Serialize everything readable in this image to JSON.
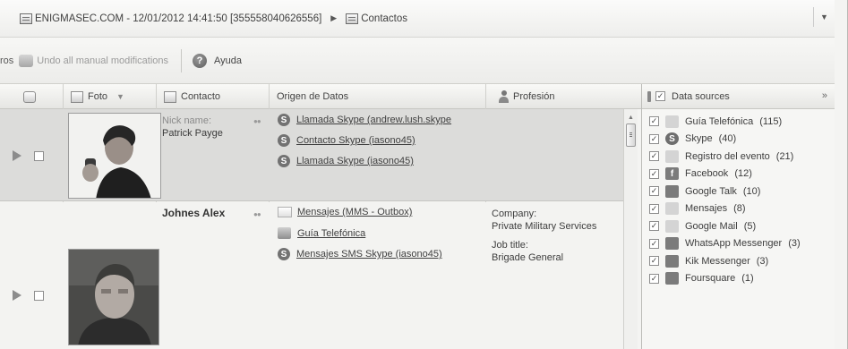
{
  "title_bar": {
    "device_label": "ENIGMASEC.COM - 12/01/2012 14:41:50 [355558040626556]",
    "separator": "▶",
    "section_label": "Contactos",
    "dropdown_glyph": "▼"
  },
  "toolbar": {
    "left_truncated": "ros",
    "undo_label": "Undo all manual modifications",
    "help_label": "Ayuda"
  },
  "grid": {
    "columns": {
      "foto": "Foto",
      "contacto": "Contacto",
      "origen": "Origen de Datos",
      "profesion": "Profesión"
    },
    "rows": [
      {
        "nick_label": "Nick name:",
        "name": "Patrick Payge",
        "sources": [
          {
            "icon": "skype-icon",
            "text": "Llamada Skype (andrew.lush.skype"
          },
          {
            "icon": "skype-icon",
            "text": "Contacto Skype (iasono45)"
          },
          {
            "icon": "skype-icon",
            "text": "Llamada Skype (iasono45)"
          }
        ]
      },
      {
        "name": "Johnes Alex",
        "sources": [
          {
            "icon": "mms-icon",
            "text": "Mensajes (MMS - Outbox)"
          },
          {
            "icon": "phonebook-icon",
            "text": "Guía Telefónica"
          },
          {
            "icon": "skype-icon",
            "text": "Mensajes SMS Skype (iasono45)"
          }
        ],
        "company_label": "Company:",
        "company_value": "Private Military Services",
        "jobtitle_label": "Job title:",
        "jobtitle_value": "Brigade General"
      }
    ]
  },
  "panel": {
    "title": "Data sources",
    "expand_glyph": "»",
    "items": [
      {
        "icon": "phonebook-icon",
        "label": "Guía Telefónica",
        "count": "(115)"
      },
      {
        "icon": "skype-icon",
        "label": "Skype",
        "count": "(40)"
      },
      {
        "icon": "event-log-icon",
        "label": "Registro del evento",
        "count": "(21)"
      },
      {
        "icon": "facebook-icon",
        "label": "Facebook",
        "count": "(12)"
      },
      {
        "icon": "google-talk-icon",
        "label": "Google Talk",
        "count": "(10)"
      },
      {
        "icon": "messages-icon",
        "label": "Mensajes",
        "count": "(8)"
      },
      {
        "icon": "google-mail-icon",
        "label": "Google Mail",
        "count": "(5)"
      },
      {
        "icon": "whatsapp-icon",
        "label": "WhatsApp Messenger",
        "count": "(3)"
      },
      {
        "icon": "kik-icon",
        "label": "Kik Messenger",
        "count": "(3)"
      },
      {
        "icon": "foursquare-icon",
        "label": "Foursquare",
        "count": "(1)"
      }
    ]
  },
  "icon_glyphs": {
    "skype": "S",
    "check": "✓",
    "facebook": "f",
    "help": "?"
  }
}
